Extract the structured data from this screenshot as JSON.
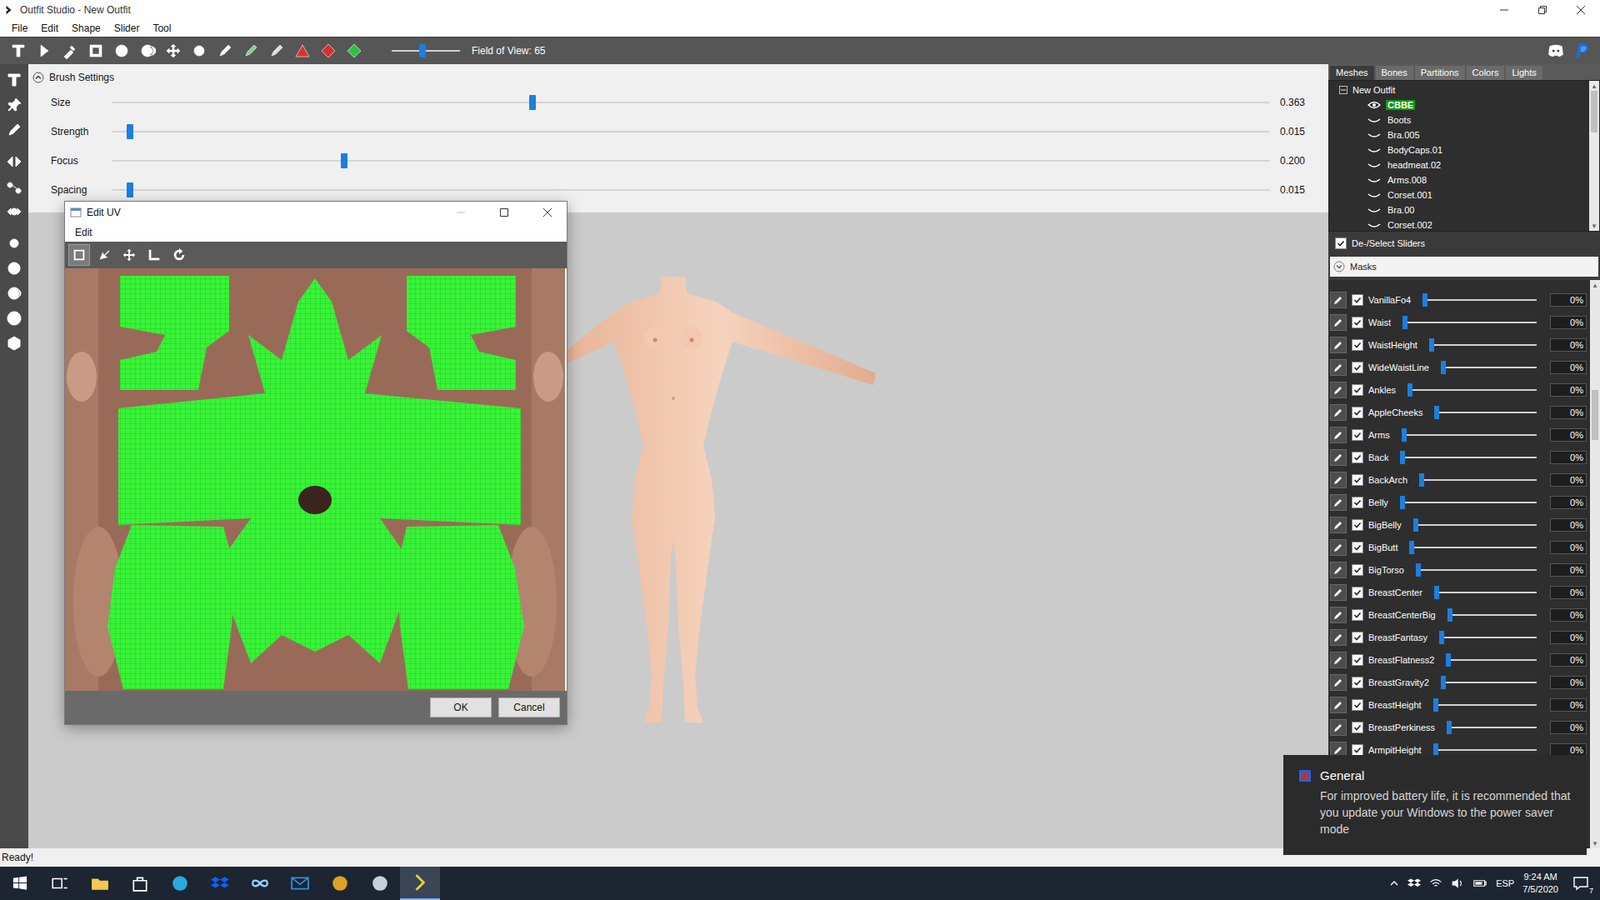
{
  "window": {
    "title": "Outfit Studio - New Outfit"
  },
  "menu": [
    "File",
    "Edit",
    "Shape",
    "Slider",
    "Tool"
  ],
  "toolbar": {
    "fov_label": "Field of View: 65",
    "fov_level": 0.45
  },
  "brush_settings": {
    "title": "Brush Settings",
    "expanded": true,
    "rows": [
      {
        "label": "Size",
        "level": 0.363,
        "value": "0.363"
      },
      {
        "label": "Strength",
        "level": 0.015,
        "value": "0.015"
      },
      {
        "label": "Focus",
        "level": 0.2,
        "value": "0.200"
      },
      {
        "label": "Spacing",
        "level": 0.015,
        "value": "0.015"
      }
    ]
  },
  "right_panel": {
    "tabs": [
      {
        "label": "Meshes",
        "selected": true
      },
      {
        "label": "Bones",
        "selected": false
      },
      {
        "label": "Partitions",
        "selected": false
      },
      {
        "label": "Colors",
        "selected": false
      },
      {
        "label": "Lights",
        "selected": false
      }
    ],
    "tree": {
      "root": "New Outfit",
      "expanded": true,
      "items": [
        {
          "name": "CBBE",
          "selected": true,
          "visible": true
        },
        {
          "name": "Boots",
          "selected": false,
          "visible": false
        },
        {
          "name": "Bra.005",
          "selected": false,
          "visible": false
        },
        {
          "name": "BodyCaps.01",
          "selected": false,
          "visible": false
        },
        {
          "name": "headmeat.02",
          "selected": false,
          "visible": false
        },
        {
          "name": "Arms.008",
          "selected": false,
          "visible": false
        },
        {
          "name": "Corset.001",
          "selected": false,
          "visible": false
        },
        {
          "name": "Bra.00",
          "selected": false,
          "visible": false
        },
        {
          "name": "Corset.002",
          "selected": false,
          "visible": false
        }
      ]
    },
    "deselect_sliders": {
      "label": "De-/Select Sliders",
      "checked": true
    },
    "masks": {
      "label": "Masks",
      "expanded": false
    },
    "sliders": [
      {
        "name": "VanillaFo4",
        "checked": true,
        "level": 0,
        "value": "0%"
      },
      {
        "name": "Waist",
        "checked": true,
        "level": 0,
        "value": "0%"
      },
      {
        "name": "WaistHeight",
        "checked": true,
        "level": 0,
        "value": "0%"
      },
      {
        "name": "WideWaistLine",
        "checked": true,
        "level": 0,
        "value": "0%"
      },
      {
        "name": "Ankles",
        "checked": true,
        "level": 0,
        "value": "0%"
      },
      {
        "name": "AppleCheeks",
        "checked": true,
        "level": 0,
        "value": "0%"
      },
      {
        "name": "Arms",
        "checked": true,
        "level": 0,
        "value": "0%"
      },
      {
        "name": "Back",
        "checked": true,
        "level": 0,
        "value": "0%"
      },
      {
        "name": "BackArch",
        "checked": true,
        "level": 0,
        "value": "0%"
      },
      {
        "name": "Belly",
        "checked": true,
        "level": 0,
        "value": "0%"
      },
      {
        "name": "BigBelly",
        "checked": true,
        "level": 0,
        "value": "0%"
      },
      {
        "name": "BigButt",
        "checked": true,
        "level": 0,
        "value": "0%"
      },
      {
        "name": "BigTorso",
        "checked": true,
        "level": 0,
        "value": "0%"
      },
      {
        "name": "BreastCenter",
        "checked": true,
        "level": 0,
        "value": "0%"
      },
      {
        "name": "BreastCenterBig",
        "checked": true,
        "level": 0,
        "value": "0%"
      },
      {
        "name": "BreastFantasy",
        "checked": true,
        "level": 0,
        "value": "0%"
      },
      {
        "name": "BreastFlatness2",
        "checked": true,
        "level": 0,
        "value": "0%"
      },
      {
        "name": "BreastGravity2",
        "checked": true,
        "level": 0,
        "value": "0%"
      },
      {
        "name": "BreastHeight",
        "checked": true,
        "level": 0,
        "value": "0%"
      },
      {
        "name": "BreastPerkiness",
        "checked": true,
        "level": 0,
        "value": "0%"
      },
      {
        "name": "ArmpitHeight",
        "checked": true,
        "level": 0,
        "value": "0%"
      }
    ]
  },
  "status_bar": "Ready!",
  "uv_dialog": {
    "title": "Edit UV",
    "menu": [
      "Edit"
    ],
    "buttons": [
      "OK",
      "Cancel"
    ]
  },
  "notification": {
    "title": "General",
    "text": "For improved battery life, it is recommended that you update your Windows to the power saver mode"
  },
  "taskbar": {
    "language": "ESP",
    "time": "9:24 AM",
    "date": "7/5/2020",
    "notifications": "7"
  }
}
